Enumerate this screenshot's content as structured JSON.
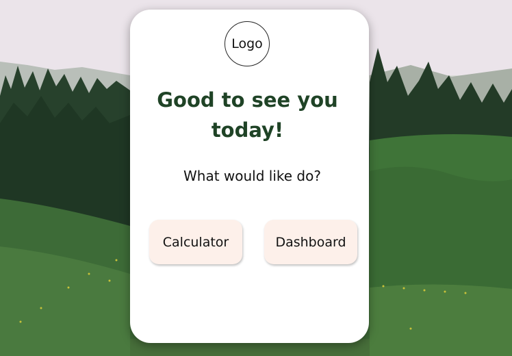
{
  "card": {
    "logo_text": "Logo",
    "headline_line1": "Good to see you",
    "headline_line2": "today!",
    "subtitle": "What would like do?"
  },
  "buttons": {
    "calculator_label": "Calculator",
    "dashboard_label": "Dashboard"
  },
  "colors": {
    "headline": "#1f4326",
    "button_bg": "#fdf0ea",
    "card_bg": "#ffffff"
  }
}
